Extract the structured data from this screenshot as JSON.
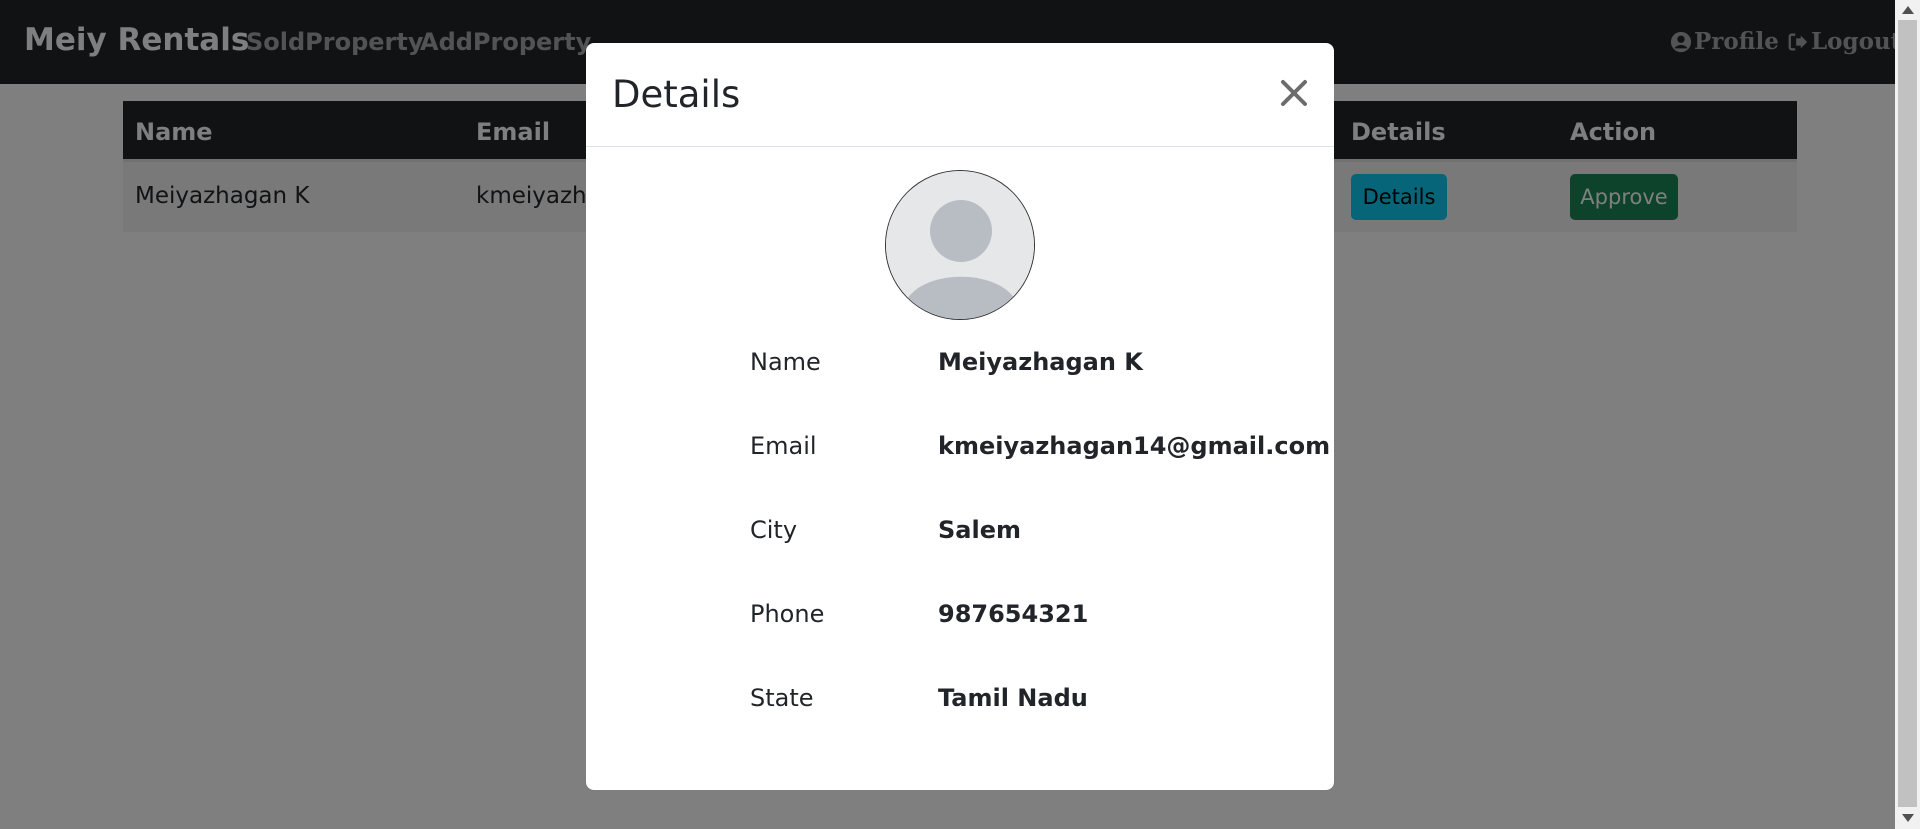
{
  "navbar": {
    "brand": "Meiy Rentals",
    "links": [
      "SoldProperty",
      "AddProperty"
    ],
    "profile_label": "Profile",
    "logout_label": "Logout"
  },
  "table": {
    "headers": [
      "Name",
      "Email",
      "Details",
      "Action"
    ],
    "rows": [
      {
        "name": "Meiyazhagan K",
        "email_visible": "kmeiyazha",
        "details_button": "Details",
        "action_button": "Approve"
      }
    ]
  },
  "modal": {
    "title": "Details",
    "close_icon": "close-icon",
    "avatar_icon": "user-avatar-icon",
    "fields": [
      {
        "label": "Name",
        "value": "Meiyazhagan K"
      },
      {
        "label": "Email",
        "value": "kmeiyazhagan14@gmail.com"
      },
      {
        "label": "City",
        "value": "Salem"
      },
      {
        "label": "Phone",
        "value": "987654321"
      },
      {
        "label": "State",
        "value": "Tamil Nadu"
      }
    ]
  },
  "colors": {
    "navbar_bg": "#212529",
    "details_button_bg": "#0dcaf0",
    "approve_button_bg": "#198754"
  }
}
